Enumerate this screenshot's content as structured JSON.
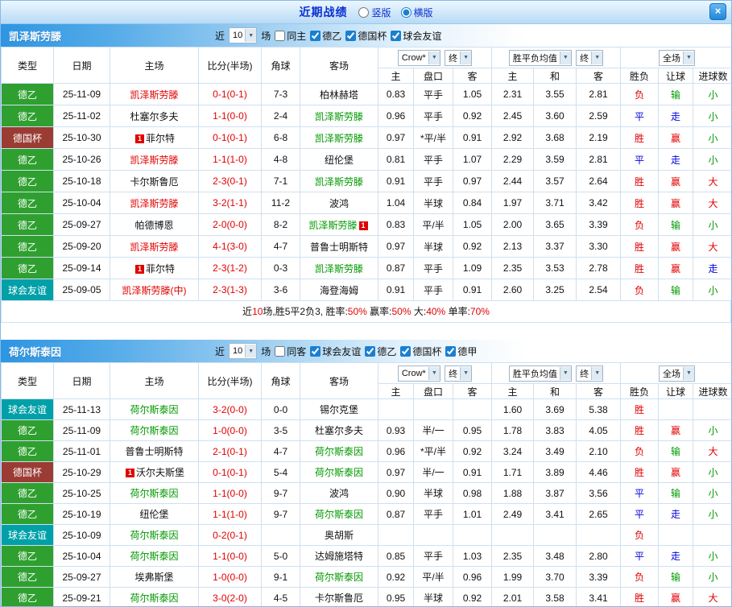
{
  "titlebar": {
    "title": "近期战绩",
    "options": [
      {
        "label": "竖版",
        "checked": false
      },
      {
        "label": "横版",
        "checked": true
      }
    ],
    "close": "×"
  },
  "palette": {
    "red": "#e10000",
    "green": "#009900",
    "blue": "#0000dd",
    "black": "#111111"
  },
  "league_colors": {
    "德乙": "#2fa030",
    "德国杯": "#9a3c34",
    "球会友谊": "#00a0a8",
    "德甲": "#2fa030"
  },
  "header": {
    "type": "类型",
    "date": "日期",
    "home": "主场",
    "score": "比分(半场)",
    "corner": "角球",
    "away": "客场",
    "book_select": "Crow*",
    "final_label": "终",
    "europe_select": "胜平负均值",
    "scope_select": "全场",
    "sub": [
      "主",
      "盘口",
      "客",
      "主",
      "和",
      "客",
      "胜负",
      "让球",
      "进球数"
    ]
  },
  "sections": [
    {
      "team": "凯泽斯劳滕",
      "filter": {
        "near": "近",
        "count": "10",
        "games": "场",
        "venue": {
          "label": "同主",
          "checked": false
        },
        "leagues": [
          {
            "label": "德乙",
            "checked": true
          },
          {
            "label": "德国杯",
            "checked": true
          },
          {
            "label": "球会友谊",
            "checked": true
          }
        ]
      },
      "rows": [
        {
          "lg": "德乙",
          "date": "25-11-09",
          "home": "凯泽斯劳滕",
          "home_c": "red",
          "home_pre": "",
          "home_post": "",
          "score": "0-1(0-1)",
          "corner": "7-3",
          "away": "柏林赫塔",
          "away_c": "black",
          "away_pre": "",
          "away_post": "",
          "odds": [
            "0.83",
            "平手",
            "1.05"
          ],
          "avg": [
            "2.31",
            "3.55",
            "2.81"
          ],
          "res": [
            "负",
            "red"
          ],
          "han": [
            "输",
            "green"
          ],
          "goal": [
            "小",
            "green"
          ]
        },
        {
          "lg": "德乙",
          "date": "25-11-02",
          "home": "杜塞尔多夫",
          "home_c": "black",
          "home_pre": "",
          "home_post": "",
          "score": "1-1(0-0)",
          "corner": "2-4",
          "away": "凯泽斯劳滕",
          "away_c": "green",
          "away_pre": "",
          "away_post": "",
          "odds": [
            "0.96",
            "平手",
            "0.92"
          ],
          "avg": [
            "2.45",
            "3.60",
            "2.59"
          ],
          "res": [
            "平",
            "blue"
          ],
          "han": [
            "走",
            "blue"
          ],
          "goal": [
            "小",
            "green"
          ]
        },
        {
          "lg": "德国杯",
          "date": "25-10-30",
          "home": "菲尔特",
          "home_c": "black",
          "home_pre": "1",
          "home_post": "",
          "score": "0-1(0-1)",
          "corner": "6-8",
          "away": "凯泽斯劳滕",
          "away_c": "green",
          "away_pre": "",
          "away_post": "",
          "odds": [
            "0.97",
            "*平/半",
            "0.91"
          ],
          "avg": [
            "2.92",
            "3.68",
            "2.19"
          ],
          "res": [
            "胜",
            "red"
          ],
          "han": [
            "赢",
            "red"
          ],
          "goal": [
            "小",
            "green"
          ]
        },
        {
          "lg": "德乙",
          "date": "25-10-26",
          "home": "凯泽斯劳滕",
          "home_c": "red",
          "home_pre": "",
          "home_post": "",
          "score": "1-1(1-0)",
          "corner": "4-8",
          "away": "纽伦堡",
          "away_c": "black",
          "away_pre": "",
          "away_post": "",
          "odds": [
            "0.81",
            "平手",
            "1.07"
          ],
          "avg": [
            "2.29",
            "3.59",
            "2.81"
          ],
          "res": [
            "平",
            "blue"
          ],
          "han": [
            "走",
            "blue"
          ],
          "goal": [
            "小",
            "green"
          ]
        },
        {
          "lg": "德乙",
          "date": "25-10-18",
          "home": "卡尔斯鲁厄",
          "home_c": "black",
          "home_pre": "",
          "home_post": "",
          "score": "2-3(0-1)",
          "corner": "7-1",
          "away": "凯泽斯劳滕",
          "away_c": "green",
          "away_pre": "",
          "away_post": "",
          "odds": [
            "0.91",
            "平手",
            "0.97"
          ],
          "avg": [
            "2.44",
            "3.57",
            "2.64"
          ],
          "res": [
            "胜",
            "red"
          ],
          "han": [
            "赢",
            "red"
          ],
          "goal": [
            "大",
            "red"
          ]
        },
        {
          "lg": "德乙",
          "date": "25-10-04",
          "home": "凯泽斯劳滕",
          "home_c": "red",
          "home_pre": "",
          "home_post": "",
          "score": "3-2(1-1)",
          "corner": "11-2",
          "away": "波鸿",
          "away_c": "black",
          "away_pre": "",
          "away_post": "",
          "odds": [
            "1.04",
            "半球",
            "0.84"
          ],
          "avg": [
            "1.97",
            "3.71",
            "3.42"
          ],
          "res": [
            "胜",
            "red"
          ],
          "han": [
            "赢",
            "red"
          ],
          "goal": [
            "大",
            "red"
          ]
        },
        {
          "lg": "德乙",
          "date": "25-09-27",
          "home": "帕德博恩",
          "home_c": "black",
          "home_pre": "",
          "home_post": "",
          "score": "2-0(0-0)",
          "corner": "8-2",
          "away": "凯泽斯劳滕",
          "away_c": "green",
          "away_pre": "",
          "away_post": "1",
          "odds": [
            "0.83",
            "平/半",
            "1.05"
          ],
          "avg": [
            "2.00",
            "3.65",
            "3.39"
          ],
          "res": [
            "负",
            "red"
          ],
          "han": [
            "输",
            "green"
          ],
          "goal": [
            "小",
            "green"
          ]
        },
        {
          "lg": "德乙",
          "date": "25-09-20",
          "home": "凯泽斯劳滕",
          "home_c": "red",
          "home_pre": "",
          "home_post": "",
          "score": "4-1(3-0)",
          "corner": "4-7",
          "away": "普鲁士明斯特",
          "away_c": "black",
          "away_pre": "",
          "away_post": "",
          "odds": [
            "0.97",
            "半球",
            "0.92"
          ],
          "avg": [
            "2.13",
            "3.37",
            "3.30"
          ],
          "res": [
            "胜",
            "red"
          ],
          "han": [
            "赢",
            "red"
          ],
          "goal": [
            "大",
            "red"
          ]
        },
        {
          "lg": "德乙",
          "date": "25-09-14",
          "home": "菲尔特",
          "home_c": "black",
          "home_pre": "1",
          "home_post": "",
          "score": "2-3(1-2)",
          "corner": "0-3",
          "away": "凯泽斯劳滕",
          "away_c": "green",
          "away_pre": "",
          "away_post": "",
          "odds": [
            "0.87",
            "平手",
            "1.09"
          ],
          "avg": [
            "2.35",
            "3.53",
            "2.78"
          ],
          "res": [
            "胜",
            "red"
          ],
          "han": [
            "赢",
            "red"
          ],
          "goal": [
            "走",
            "blue"
          ]
        },
        {
          "lg": "球会友谊",
          "date": "25-09-05",
          "home": "凯泽斯劳滕(中)",
          "home_c": "red",
          "home_pre": "",
          "home_post": "",
          "score": "2-3(1-3)",
          "corner": "3-6",
          "away": "海登海姆",
          "away_c": "black",
          "away_pre": "",
          "away_post": "",
          "odds": [
            "0.91",
            "平手",
            "0.91"
          ],
          "avg": [
            "2.60",
            "3.25",
            "2.54"
          ],
          "res": [
            "负",
            "red"
          ],
          "han": [
            "输",
            "green"
          ],
          "goal": [
            "小",
            "green"
          ]
        }
      ],
      "summary": [
        {
          "t": "近",
          "c": "black"
        },
        {
          "t": "10",
          "c": "red"
        },
        {
          "t": "场,胜5平2负3, ",
          "c": "black"
        },
        {
          "t": "胜率:",
          "c": "black"
        },
        {
          "t": "50%",
          "c": "red"
        },
        {
          "t": " 赢率:",
          "c": "black"
        },
        {
          "t": "50%",
          "c": "red"
        },
        {
          "t": " 大:",
          "c": "black"
        },
        {
          "t": "40%",
          "c": "red"
        },
        {
          "t": " 单率:",
          "c": "black"
        },
        {
          "t": "70%",
          "c": "red"
        }
      ]
    },
    {
      "team": "荷尔斯泰因",
      "filter": {
        "near": "近",
        "count": "10",
        "games": "场",
        "venue": {
          "label": "同客",
          "checked": false
        },
        "leagues": [
          {
            "label": "球会友谊",
            "checked": true
          },
          {
            "label": "德乙",
            "checked": true
          },
          {
            "label": "德国杯",
            "checked": true
          },
          {
            "label": "德甲",
            "checked": true
          }
        ]
      },
      "rows": [
        {
          "lg": "球会友谊",
          "date": "25-11-13",
          "home": "荷尔斯泰因",
          "home_c": "green",
          "home_pre": "",
          "home_post": "",
          "score": "3-2(0-0)",
          "corner": "0-0",
          "away": "锡尔克堡",
          "away_c": "black",
          "away_pre": "",
          "away_post": "",
          "odds": [
            "",
            "",
            ""
          ],
          "avg": [
            "1.60",
            "3.69",
            "5.38"
          ],
          "res": [
            "胜",
            "red"
          ],
          "han": [
            "",
            ""
          ],
          "goal": [
            "",
            ""
          ]
        },
        {
          "lg": "德乙",
          "date": "25-11-09",
          "home": "荷尔斯泰因",
          "home_c": "green",
          "home_pre": "",
          "home_post": "",
          "score": "1-0(0-0)",
          "corner": "3-5",
          "away": "杜塞尔多夫",
          "away_c": "black",
          "away_pre": "",
          "away_post": "",
          "odds": [
            "0.93",
            "半/一",
            "0.95"
          ],
          "avg": [
            "1.78",
            "3.83",
            "4.05"
          ],
          "res": [
            "胜",
            "red"
          ],
          "han": [
            "赢",
            "red"
          ],
          "goal": [
            "小",
            "green"
          ]
        },
        {
          "lg": "德乙",
          "date": "25-11-01",
          "home": "普鲁士明斯特",
          "home_c": "black",
          "home_pre": "",
          "home_post": "",
          "score": "2-1(0-1)",
          "corner": "4-7",
          "away": "荷尔斯泰因",
          "away_c": "green",
          "away_pre": "",
          "away_post": "",
          "odds": [
            "0.96",
            "*平/半",
            "0.92"
          ],
          "avg": [
            "3.24",
            "3.49",
            "2.10"
          ],
          "res": [
            "负",
            "red"
          ],
          "han": [
            "输",
            "green"
          ],
          "goal": [
            "大",
            "red"
          ]
        },
        {
          "lg": "德国杯",
          "date": "25-10-29",
          "home": "沃尔夫斯堡",
          "home_c": "black",
          "home_pre": "1",
          "home_post": "",
          "score": "0-1(0-1)",
          "corner": "5-4",
          "away": "荷尔斯泰因",
          "away_c": "green",
          "away_pre": "",
          "away_post": "",
          "odds": [
            "0.97",
            "半/一",
            "0.91"
          ],
          "avg": [
            "1.71",
            "3.89",
            "4.46"
          ],
          "res": [
            "胜",
            "red"
          ],
          "han": [
            "赢",
            "red"
          ],
          "goal": [
            "小",
            "green"
          ]
        },
        {
          "lg": "德乙",
          "date": "25-10-25",
          "home": "荷尔斯泰因",
          "home_c": "green",
          "home_pre": "",
          "home_post": "",
          "score": "1-1(0-0)",
          "corner": "9-7",
          "away": "波鸿",
          "away_c": "black",
          "away_pre": "",
          "away_post": "",
          "odds": [
            "0.90",
            "半球",
            "0.98"
          ],
          "avg": [
            "1.88",
            "3.87",
            "3.56"
          ],
          "res": [
            "平",
            "blue"
          ],
          "han": [
            "输",
            "green"
          ],
          "goal": [
            "小",
            "green"
          ]
        },
        {
          "lg": "德乙",
          "date": "25-10-19",
          "home": "纽伦堡",
          "home_c": "black",
          "home_pre": "",
          "home_post": "",
          "score": "1-1(1-0)",
          "corner": "9-7",
          "away": "荷尔斯泰因",
          "away_c": "green",
          "away_pre": "",
          "away_post": "",
          "odds": [
            "0.87",
            "平手",
            "1.01"
          ],
          "avg": [
            "2.49",
            "3.41",
            "2.65"
          ],
          "res": [
            "平",
            "blue"
          ],
          "han": [
            "走",
            "blue"
          ],
          "goal": [
            "小",
            "green"
          ]
        },
        {
          "lg": "球会友谊",
          "date": "25-10-09",
          "home": "荷尔斯泰因",
          "home_c": "green",
          "home_pre": "",
          "home_post": "",
          "score": "0-2(0-1)",
          "corner": "",
          "away": "奥胡斯",
          "away_c": "black",
          "away_pre": "",
          "away_post": "",
          "odds": [
            "",
            "",
            ""
          ],
          "avg": [
            "",
            "",
            ""
          ],
          "res": [
            "负",
            "red"
          ],
          "han": [
            "",
            ""
          ],
          "goal": [
            "",
            ""
          ]
        },
        {
          "lg": "德乙",
          "date": "25-10-04",
          "home": "荷尔斯泰因",
          "home_c": "green",
          "home_pre": "",
          "home_post": "",
          "score": "1-1(0-0)",
          "corner": "5-0",
          "away": "达姆施塔特",
          "away_c": "black",
          "away_pre": "",
          "away_post": "",
          "odds": [
            "0.85",
            "平手",
            "1.03"
          ],
          "avg": [
            "2.35",
            "3.48",
            "2.80"
          ],
          "res": [
            "平",
            "blue"
          ],
          "han": [
            "走",
            "blue"
          ],
          "goal": [
            "小",
            "green"
          ]
        },
        {
          "lg": "德乙",
          "date": "25-09-27",
          "home": "埃弗斯堡",
          "home_c": "black",
          "home_pre": "",
          "home_post": "",
          "score": "1-0(0-0)",
          "corner": "9-1",
          "away": "荷尔斯泰因",
          "away_c": "green",
          "away_pre": "",
          "away_post": "",
          "odds": [
            "0.92",
            "平/半",
            "0.96"
          ],
          "avg": [
            "1.99",
            "3.70",
            "3.39"
          ],
          "res": [
            "负",
            "red"
          ],
          "han": [
            "输",
            "green"
          ],
          "goal": [
            "小",
            "green"
          ]
        },
        {
          "lg": "德乙",
          "date": "25-09-21",
          "home": "荷尔斯泰因",
          "home_c": "green",
          "home_pre": "",
          "home_post": "",
          "score": "3-0(2-0)",
          "corner": "4-5",
          "away": "卡尔斯鲁厄",
          "away_c": "black",
          "away_pre": "",
          "away_post": "",
          "odds": [
            "0.95",
            "半球",
            "0.92"
          ],
          "avg": [
            "2.01",
            "3.58",
            "3.41"
          ],
          "res": [
            "胜",
            "red"
          ],
          "han": [
            "赢",
            "red"
          ],
          "goal": [
            "大",
            "red"
          ]
        }
      ],
      "summary": []
    }
  ]
}
